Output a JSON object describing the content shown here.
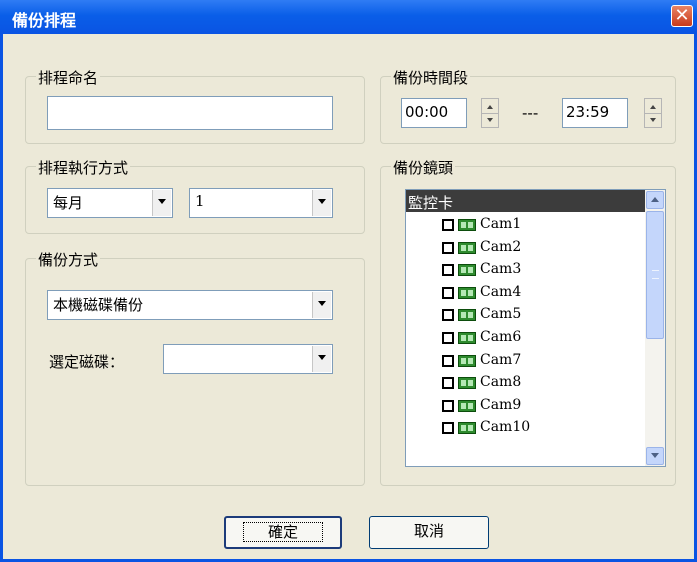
{
  "window": {
    "title": "備份排程"
  },
  "schedule_name": {
    "legend": "排程命名",
    "value": ""
  },
  "time_range": {
    "legend": "備份時間段",
    "start": "00:00",
    "separator": "---",
    "end": "23:59"
  },
  "exec_method": {
    "legend": "排程執行方式",
    "period": "每月",
    "day": "1"
  },
  "backup_method": {
    "legend": "備份方式",
    "method": "本機磁碟備份",
    "disk_label": "選定磁碟：",
    "disk": ""
  },
  "cameras": {
    "legend": "備份鏡頭",
    "root": "監控卡",
    "items": [
      "Cam1",
      "Cam2",
      "Cam3",
      "Cam4",
      "Cam5",
      "Cam6",
      "Cam7",
      "Cam8",
      "Cam9",
      "Cam10"
    ]
  },
  "buttons": {
    "ok": "確定",
    "cancel": "取消"
  }
}
